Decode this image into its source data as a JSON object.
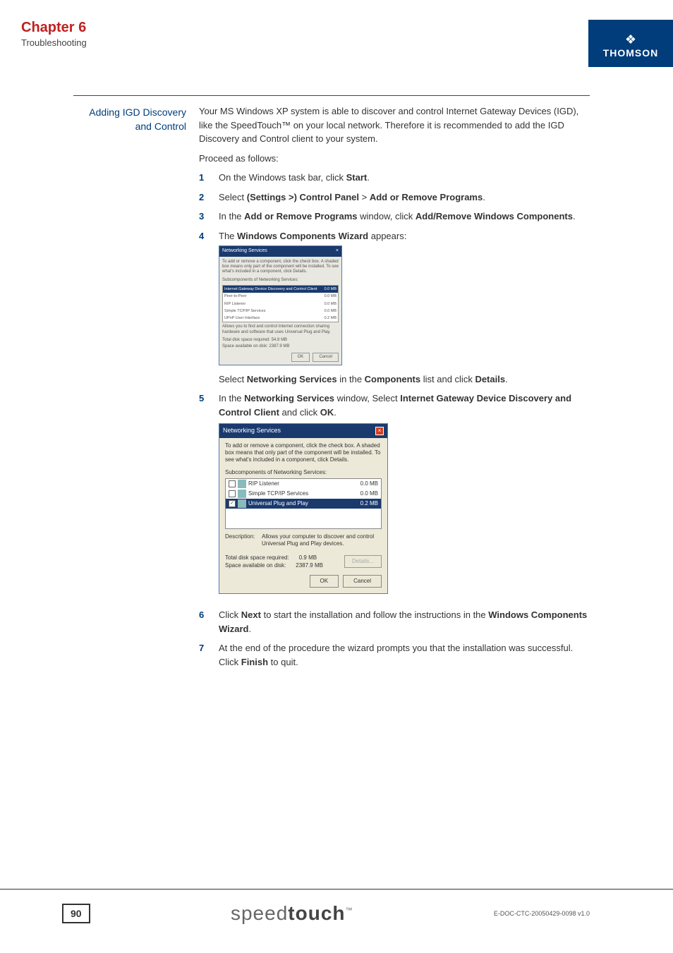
{
  "header": {
    "chapter_title": "Chapter 6",
    "chapter_subtitle": "Troubleshooting",
    "brand": "THOMSON"
  },
  "side_heading": "Adding IGD Discovery and Control",
  "intro_para": "Your MS Windows XP system is able to discover and control Internet Gateway Devices (IGD), like the SpeedTouch™ on your local network. Therefore it is recommended to add the IGD Discovery and Control client to your system.",
  "proceed": "Proceed as follows:",
  "steps": {
    "s1_a": "On the Windows task bar, click ",
    "s1_b": "Start",
    "s1_c": ".",
    "s2_a": "Select ",
    "s2_b": "(Settings >) Control Panel",
    "s2_gt": " > ",
    "s2_c": "Add or Remove Programs",
    "s2_d": ".",
    "s3_a": "In the ",
    "s3_b": "Add or Remove Programs",
    "s3_c": " window, click ",
    "s3_d": "Add/Remove Windows Components",
    "s3_e": ".",
    "s4_a": "The ",
    "s4_b": "Windows Components Wizard",
    "s4_c": " appears:",
    "s4_after_a": "Select ",
    "s4_after_b": "Networking Services",
    "s4_after_c": " in the ",
    "s4_after_d": "Components",
    "s4_after_e": " list and click ",
    "s4_after_f": "Details",
    "s4_after_g": ".",
    "s5_a": "In the ",
    "s5_b": "Networking Services",
    "s5_c": " window, Select ",
    "s5_d": "Internet Gateway Device Discovery and Control Client",
    "s5_e": " and click ",
    "s5_f": "OK",
    "s5_g": ".",
    "s6_a": "Click ",
    "s6_b": "Next",
    "s6_c": " to start the installation and follow the instructions in the ",
    "s6_d": "Windows Components Wizard",
    "s6_e": ".",
    "s7_a": "At the end of the procedure the wizard prompts you that the installation was successful. Click ",
    "s7_b": "Finish",
    "s7_c": " to quit."
  },
  "ss1": {
    "title": "Networking Services",
    "intro": "To add or remove a component, click the check box. A shaded box means only part of the component will be installed. To see what's included in a component, click Details.",
    "sublabel": "Subcomponents of Networking Services:",
    "items": [
      {
        "name": "Internet Gateway Device Discovery and Control Client",
        "size": "0.0 MB"
      },
      {
        "name": "Peer-to-Peer",
        "size": "0.0 MB"
      },
      {
        "name": "RIP Listener",
        "size": "0.0 MB"
      },
      {
        "name": "Simple TCP/IP Services",
        "size": "0.0 MB"
      },
      {
        "name": "UPnP User Interface",
        "size": "0.2 MB"
      }
    ],
    "desc": "Allows you to find and control Internet connection sharing hardware and software that uses Universal Plug and Play.",
    "total_label": "Total disk space required:",
    "total_val": "54.8 MB",
    "avail_label": "Space available on disk:",
    "avail_val": "2387.9 MB",
    "ok": "OK",
    "cancel": "Cancel"
  },
  "ss2": {
    "title": "Networking Services",
    "intro": "To add or remove a component, click the check box. A shaded box means that only part of the component will be installed. To see what's included in a component, click Details.",
    "sublabel": "Subcomponents of Networking Services:",
    "items": [
      {
        "name": "RIP Listener",
        "size": "0.0 MB",
        "checked": false,
        "selected": false
      },
      {
        "name": "Simple TCP/IP Services",
        "size": "0.0 MB",
        "checked": false,
        "selected": false
      },
      {
        "name": "Universal Plug and Play",
        "size": "0.2 MB",
        "checked": true,
        "selected": true
      }
    ],
    "desc_label": "Description:",
    "desc": "Allows your computer to discover and control Universal Plug and Play devices.",
    "total_label": "Total disk space required:",
    "total_val": "0.9 MB",
    "avail_label": "Space available on disk:",
    "avail_val": "2387.9 MB",
    "details": "Details...",
    "ok": "OK",
    "cancel": "Cancel"
  },
  "footer": {
    "page": "90",
    "brand_left": "speed",
    "brand_right": "touch",
    "tm": "™",
    "docid": "E-DOC-CTC-20050429-0098 v1.0"
  }
}
